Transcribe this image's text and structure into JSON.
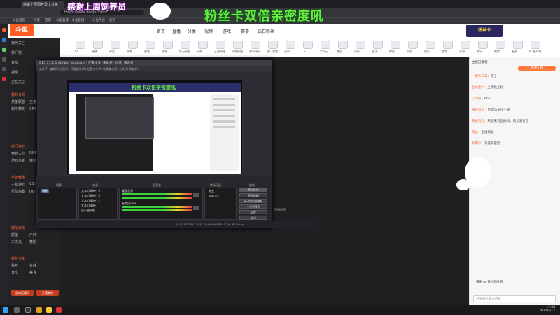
{
  "browser": {
    "tab_title": "感谢上周饲养员 | 斗鱼",
    "url": "https://www.douyu.com/",
    "bookmarks": [
      "斗鱼直播",
      "抖音",
      "百度",
      "斗鱼直播 - 斗鱼直播",
      "斗鱼平台",
      "鱼吧"
    ]
  },
  "overlay": {
    "banner": "感谢上周饲养员",
    "title": "粉丝卡双倍亲密度吼",
    "promo": "粉丝卡"
  },
  "site": {
    "logo": "斗鱼",
    "nav": [
      "首页",
      "直播",
      "分类",
      "视频",
      "游戏",
      "赛事",
      "鱼吧",
      "钻石粉丝"
    ],
    "left_nav": [
      "我的关注",
      "排行榜",
      "直播",
      "视频",
      "正在关注",
      "开播提醒"
    ],
    "left_sections": [
      {
        "title": "我的订阅",
        "items": [
          "英雄联盟",
          "王者荣耀",
          "和平精英",
          "CF手游"
        ]
      },
      {
        "title": "热门游戏",
        "items": [
          "穿越火线",
          "DNF",
          "炉石传说",
          "魔兽世界"
        ]
      },
      {
        "title": "手游休闲",
        "items": [
          "主机游戏",
          "CS:GO",
          "星际争霸",
          "QQ飞车"
        ]
      },
      {
        "title": "娱乐天地",
        "items": [
          "颜值",
          "户外",
          "二次元",
          "舞蹈"
        ]
      },
      {
        "title": "科技文化",
        "items": [
          "科技",
          "鱼教",
          "音乐",
          "美食"
        ]
      }
    ],
    "left_bottom_buttons": [
      "我的直播间",
      "开播教程"
    ],
    "category_bar": [
      "12",
      "直播",
      "分类",
      "鱼吧",
      "视频",
      "赛事",
      "钻石粉丝",
      "下载",
      "王者荣耀",
      "英雄联盟",
      "和平精英",
      "热门游戏",
      "主机",
      "CS",
      "二次元",
      "颜值",
      "户外",
      "生活",
      "舞蹈",
      "科技",
      "娱乐",
      "游戏",
      "手游",
      "音乐",
      "美食",
      "更多",
      "PC客户端"
    ]
  },
  "chat": {
    "header": "主播已收到",
    "gift_button": "赠送礼物",
    "messages": [
      {
        "user": "一颗大白菜",
        "text": "来了"
      },
      {
        "user": "鱼丸路人",
        "text": "主播晚上好"
      },
      {
        "user": "了无痕",
        "text": "666"
      },
      {
        "user": "系统消息",
        "text": "已成功关注主播"
      },
      {
        "user": "系统消息",
        "text": "欢迎来到直播间，请文明发言"
      },
      {
        "user": "粉丝",
        "text": "主播加油"
      },
      {
        "user": "新用户",
        "text": "双倍亲密度"
      }
    ],
    "notification": "感谢 @ 送出的礼物",
    "input_placeholder": "这里输入聊天内容"
  },
  "obs": {
    "title": "OBS 27.1.3 (64-bit, windows) - 配置文件: 未命名 - 场景: 未命名",
    "menu": [
      "文件(F)",
      "编辑(E)",
      "视图(V)",
      "停靠部件(D)",
      "配置文件(P)",
      "场景集合(S)",
      "工具(T)",
      "帮助(H)"
    ],
    "inner_title": "粉丝卡双倍亲密度吼",
    "docks": [
      "场景",
      "来源",
      "混音器",
      "转场动画",
      "控制"
    ],
    "scene": "场景",
    "sources": [
      "文本 (GDI+) 4",
      "文本 (GDI+) 3",
      "文本 (GDI+) 2",
      "文本 (GDI+)",
      "显示器采集"
    ],
    "mixer": [
      "桌面音频",
      "麦克风/Aux"
    ],
    "transition": "渐变",
    "duration": "300 ms",
    "controls": [
      "停止推流",
      "开始录制",
      "启动虚拟摄像机",
      "工作室模式",
      "设置",
      "退出"
    ],
    "status": "LIVE: 00:28:41  REC: 00:00:00  CPU: 5.3%, 60.00 fps",
    "extra": "开播设置"
  },
  "taskbar": {
    "time": "17:08",
    "date": "2023/4/17"
  },
  "colors": {
    "accent": "#ff5d23",
    "overlay_green": "#6ae842",
    "obs_bg": "#2d2d33"
  }
}
